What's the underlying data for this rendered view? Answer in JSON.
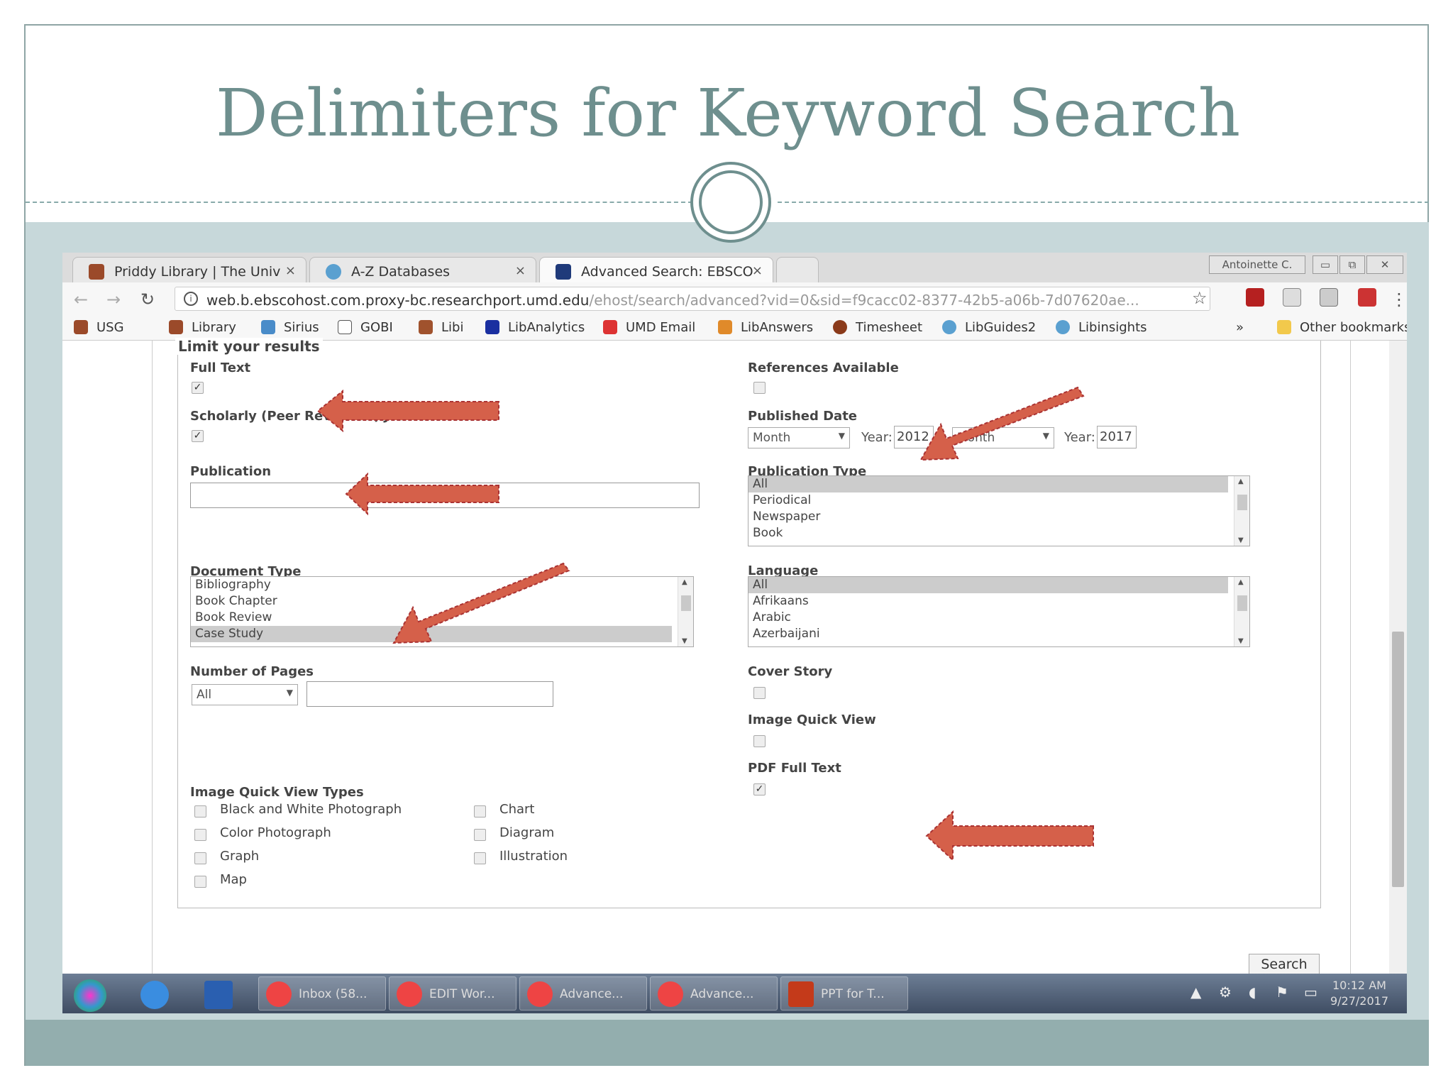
{
  "slide": {
    "title": "Delimiters for Keyword Search"
  },
  "browser": {
    "tabs": [
      {
        "label": "Priddy Library | The Univ",
        "close": "×"
      },
      {
        "label": "A-Z Databases",
        "close": "×"
      },
      {
        "label": "Advanced Search: EBSCO",
        "close": "×"
      }
    ],
    "user": "Antoinette C.",
    "url": {
      "host": "web.b.ebscohost.com.proxy-bc.researchport.umd.edu",
      "path": "/ehost/search/advanced?vid=0&sid=f9cacc02-8377-42b5-a06b-7d07620ae..."
    },
    "bookmarks": [
      "USG",
      "Library",
      "Sirius",
      "GOBI",
      "Libi",
      "LibAnalytics",
      "UMD Email",
      "LibAnswers",
      "Timesheet",
      "LibGuides2",
      "Libinsights"
    ],
    "more": "»",
    "other_bookmarks": "Other bookmarks"
  },
  "form": {
    "legend": "Limit your results",
    "full_text": {
      "label": "Full Text",
      "checked": true
    },
    "scholarly": {
      "label": "Scholarly (Peer Reviewed) Journals",
      "checked": true
    },
    "publication": {
      "label": "Publication",
      "value": ""
    },
    "references": {
      "label": "References Available",
      "checked": false
    },
    "published_date": {
      "label": "Published Date",
      "from_month": "Month",
      "from_year_label": "Year:",
      "from_year": "2012",
      "dash": "–",
      "to_month": "Month",
      "to_year_label": "Year:",
      "to_year": "2017"
    },
    "publication_type": {
      "label": "Publication Type",
      "options": [
        "All",
        "Periodical",
        "Newspaper",
        "Book"
      ],
      "selected": "All"
    },
    "document_type": {
      "label": "Document Type",
      "options": [
        "Bibliography",
        "Book Chapter",
        "Book Review",
        "Case Study"
      ],
      "selected": "Case Study"
    },
    "language": {
      "label": "Language",
      "options": [
        "All",
        "Afrikaans",
        "Arabic",
        "Azerbaijani"
      ],
      "selected": "All"
    },
    "pages": {
      "label": "Number of Pages",
      "select": "All",
      "value": ""
    },
    "cover_story": {
      "label": "Cover Story",
      "checked": false
    },
    "image_quick_view": {
      "label": "Image Quick View",
      "checked": false
    },
    "iqv_types": {
      "label": "Image Quick View Types",
      "items": [
        "Black and White Photograph",
        "Color Photograph",
        "Graph",
        "Map",
        "Chart",
        "Diagram",
        "Illustration"
      ]
    },
    "pdf_full_text": {
      "label": "PDF Full Text",
      "checked": true
    },
    "search_button": "Search"
  },
  "taskbar": {
    "items": [
      "Inbox (58...",
      "EDIT Wor...",
      "Advance...",
      "Advance...",
      "PPT for T..."
    ],
    "time": "10:12 AM",
    "date": "9/27/2017"
  },
  "colors": {
    "title": "#6e8f8e",
    "arrow": "#d5604a",
    "band": "#c7d8da"
  }
}
